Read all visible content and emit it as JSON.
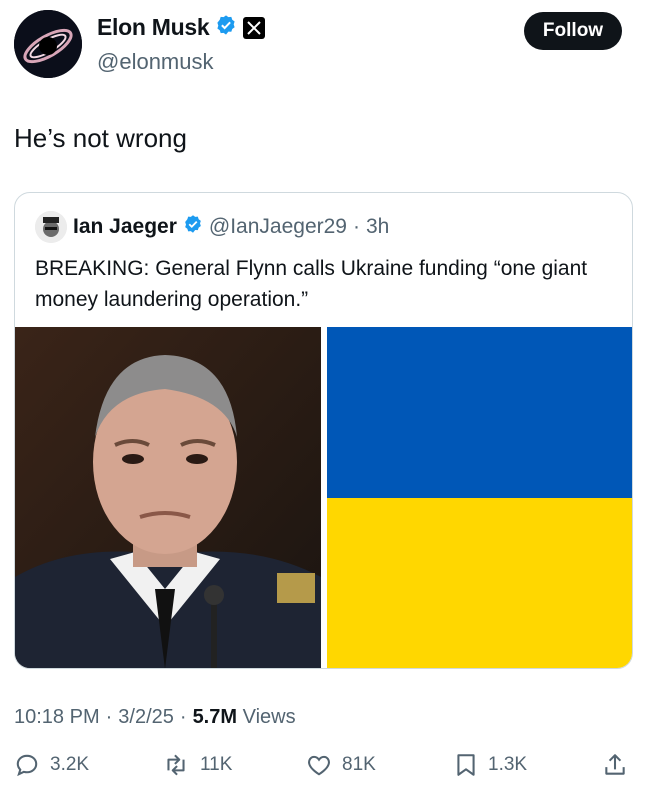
{
  "author": {
    "name": "Elon Musk",
    "handle": "@elonmusk"
  },
  "follow_label": "Follow",
  "tweet_text": "He’s not wrong",
  "quoted": {
    "name": "Ian Jaeger",
    "handle": "@IanJaeger29",
    "dot": "·",
    "time": "3h",
    "text": "BREAKING: General Flynn calls Ukraine funding “one giant money laundering operation.”"
  },
  "meta": {
    "time": "10:18 PM",
    "date": "3/2/25",
    "views": "5.7M",
    "views_label": "Views",
    "sep": "·"
  },
  "actions": {
    "replies": "3.2K",
    "reposts": "11K",
    "likes": "81K",
    "bookmarks": "1.3K"
  },
  "colors": {
    "verified": "#1d9bf0",
    "flag_blue": "#0057b7",
    "flag_yellow": "#ffd700"
  }
}
